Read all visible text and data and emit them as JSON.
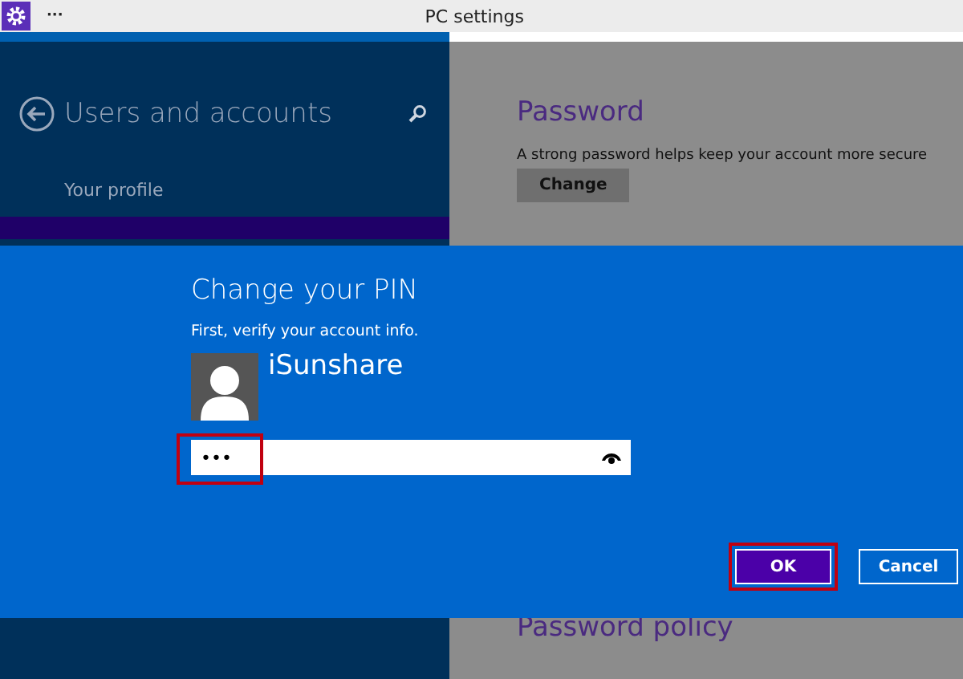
{
  "window": {
    "title": "PC settings",
    "menu_glyph": "···"
  },
  "sidebar": {
    "title": "Users and accounts",
    "items": [
      {
        "label": "Your profile",
        "selected": false
      }
    ]
  },
  "main": {
    "section_title": "Password",
    "description": "A strong password helps keep your account more secure",
    "button": "Change",
    "next_section_title": "Password policy"
  },
  "dialog": {
    "title": "Change your PIN",
    "subtitle": "First, verify your account info.",
    "user_name": "iSunshare",
    "pin_field": {
      "value": "•••",
      "highlighted": true
    },
    "buttons": [
      {
        "label": "OK",
        "primary": true,
        "highlighted": true
      },
      {
        "label": "Cancel",
        "primary": false,
        "highlighted": false
      }
    ]
  }
}
